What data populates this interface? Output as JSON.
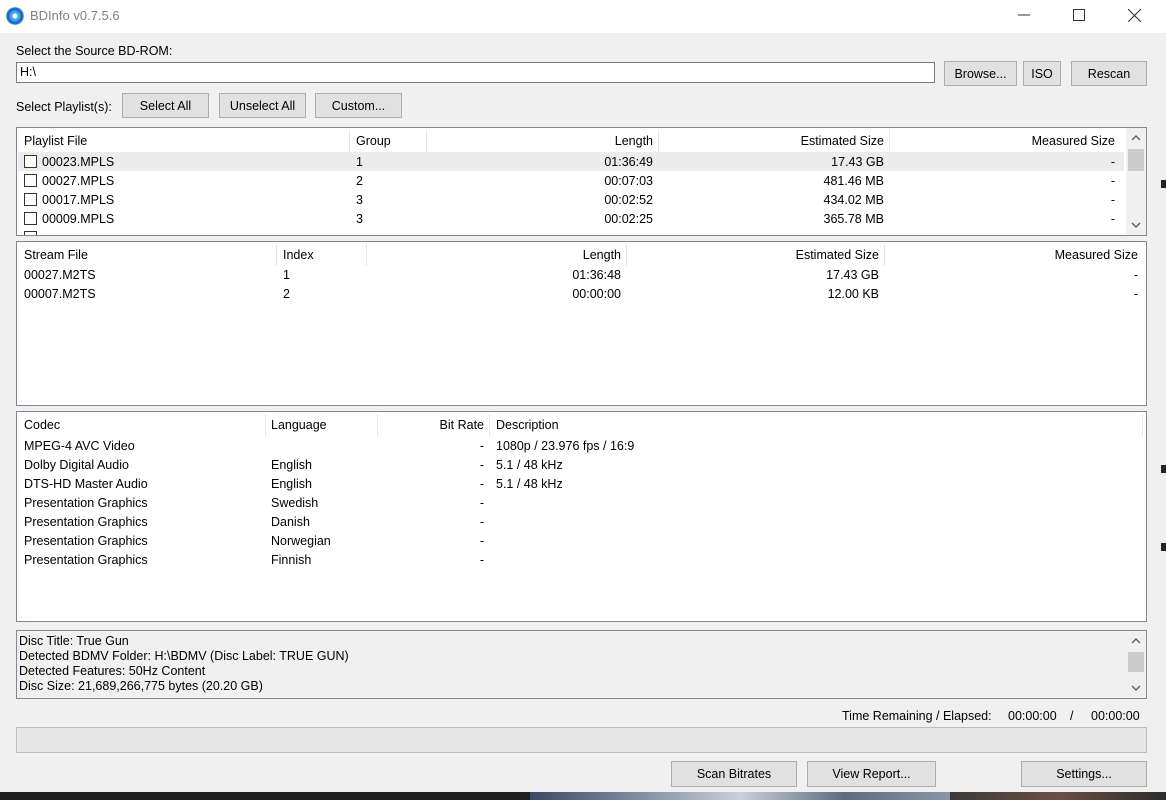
{
  "window": {
    "title": "BDInfo v0.7.5.6"
  },
  "source": {
    "label": "Select the Source BD-ROM:",
    "value": "H:\\",
    "browse": "Browse...",
    "iso": "ISO",
    "rescan": "Rescan"
  },
  "playlist_select": {
    "label": "Select Playlist(s):",
    "select_all": "Select All",
    "unselect_all": "Unselect All",
    "custom": "Custom..."
  },
  "playlists": {
    "headers": {
      "file": "Playlist File",
      "group": "Group",
      "length": "Length",
      "est_size": "Estimated Size",
      "meas_size": "Measured Size"
    },
    "rows": [
      {
        "file": "00023.MPLS",
        "group": "1",
        "length": "01:36:49",
        "est_size": "17.43 GB",
        "meas_size": "-"
      },
      {
        "file": "00027.MPLS",
        "group": "2",
        "length": "00:07:03",
        "est_size": "481.46 MB",
        "meas_size": "-"
      },
      {
        "file": "00017.MPLS",
        "group": "3",
        "length": "00:02:52",
        "est_size": "434.02 MB",
        "meas_size": "-"
      },
      {
        "file": "00009.MPLS",
        "group": "3",
        "length": "00:02:25",
        "est_size": "365.78 MB",
        "meas_size": "-"
      }
    ]
  },
  "streams": {
    "headers": {
      "file": "Stream File",
      "index": "Index",
      "length": "Length",
      "est_size": "Estimated Size",
      "meas_size": "Measured Size"
    },
    "rows": [
      {
        "file": "00027.M2TS",
        "index": "1",
        "length": "01:36:48",
        "est_size": "17.43 GB",
        "meas_size": "-"
      },
      {
        "file": "00007.M2TS",
        "index": "2",
        "length": "00:00:00",
        "est_size": "12.00 KB",
        "meas_size": "-"
      }
    ]
  },
  "codecs": {
    "headers": {
      "codec": "Codec",
      "language": "Language",
      "bitrate": "Bit Rate",
      "description": "Description"
    },
    "rows": [
      {
        "codec": "MPEG-4 AVC Video",
        "language": "",
        "bitrate": "-",
        "description": "1080p / 23.976 fps / 16:9"
      },
      {
        "codec": "Dolby Digital Audio",
        "language": "English",
        "bitrate": "-",
        "description": "5.1 / 48 kHz"
      },
      {
        "codec": "DTS-HD Master Audio",
        "language": "English",
        "bitrate": "-",
        "description": "5.1 / 48 kHz"
      },
      {
        "codec": "Presentation Graphics",
        "language": "Swedish",
        "bitrate": "-",
        "description": ""
      },
      {
        "codec": "Presentation Graphics",
        "language": "Danish",
        "bitrate": "-",
        "description": ""
      },
      {
        "codec": "Presentation Graphics",
        "language": "Norwegian",
        "bitrate": "-",
        "description": ""
      },
      {
        "codec": "Presentation Graphics",
        "language": "Finnish",
        "bitrate": "-",
        "description": ""
      }
    ]
  },
  "disc_info": [
    "Disc Title: True Gun",
    "Detected BDMV Folder: H:\\BDMV (Disc Label: TRUE GUN)",
    "Detected Features: 50Hz Content",
    "Disc Size: 21,689,266,775 bytes (20.20 GB)"
  ],
  "time": {
    "label": "Time Remaining / Elapsed:",
    "remaining": "00:00:00",
    "separator": "/",
    "elapsed": "00:00:00"
  },
  "progress": {
    "fraction": 0
  },
  "actions": {
    "scan_bitrates": "Scan Bitrates",
    "view_report": "View Report...",
    "settings": "Settings..."
  },
  "icons": {
    "app": "disc-icon",
    "minimize": "minimize-icon",
    "maximize": "maximize-icon",
    "close": "close-icon",
    "scroll_up": "chevron-up-icon",
    "scroll_down": "chevron-down-icon"
  }
}
